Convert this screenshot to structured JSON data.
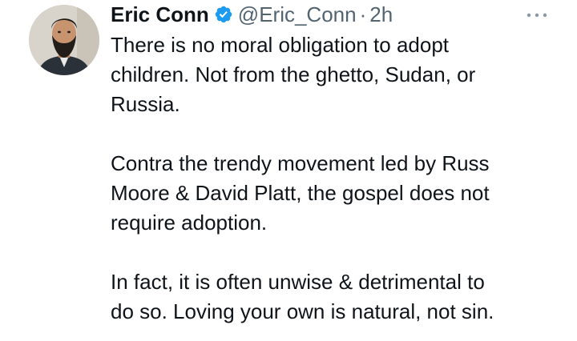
{
  "tweet": {
    "author": {
      "display_name": "Eric Conn",
      "handle": "@Eric_Conn",
      "verified": true,
      "verified_icon": "verified-badge-icon",
      "verified_color": "#1d9bf0"
    },
    "separator": "·",
    "time": "2h",
    "more_icon": "more-options-icon",
    "paragraphs": [
      "There is no moral obligation to adopt\nchildren. Not from the ghetto, Sudan, or\nRussia.",
      "Contra the trendy movement led by Russ\nMoore & David Platt, the gospel does not\nrequire adoption.",
      "In fact, it is often unwise & detrimental to\ndo so. Loving your own is natural, not sin."
    ]
  }
}
